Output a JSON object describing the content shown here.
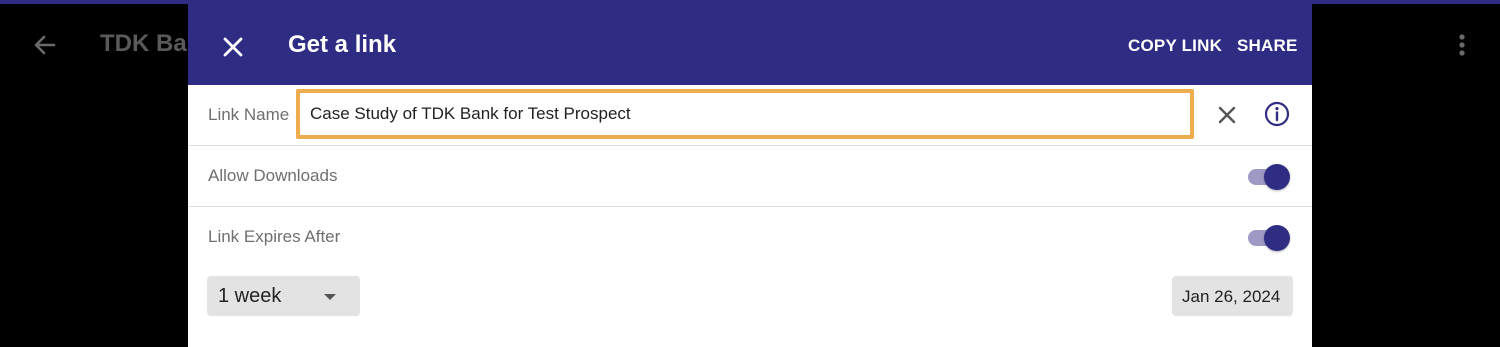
{
  "background": {
    "app_title": "TDK Bar",
    "back_icon": "arrow-left-icon",
    "more_icon": "more-vertical-icon"
  },
  "dialog": {
    "title": "Get a link",
    "close_icon": "close-icon",
    "actions": {
      "copy_link": "COPY LINK",
      "share": "SHARE"
    },
    "link_name": {
      "label": "Link Name",
      "value": "Case Study of TDK Bank for Test Prospect",
      "clear_icon": "clear-icon",
      "info_icon": "info-icon"
    },
    "allow_downloads": {
      "label": "Allow Downloads",
      "enabled": true
    },
    "link_expires": {
      "label": "Link Expires After",
      "enabled": true,
      "duration": "1 week",
      "date": "Jan 26, 2024"
    }
  },
  "colors": {
    "brand": "#2f2d83",
    "highlight": "#f0ad4e",
    "toggle_track": "#9d9bc6"
  }
}
